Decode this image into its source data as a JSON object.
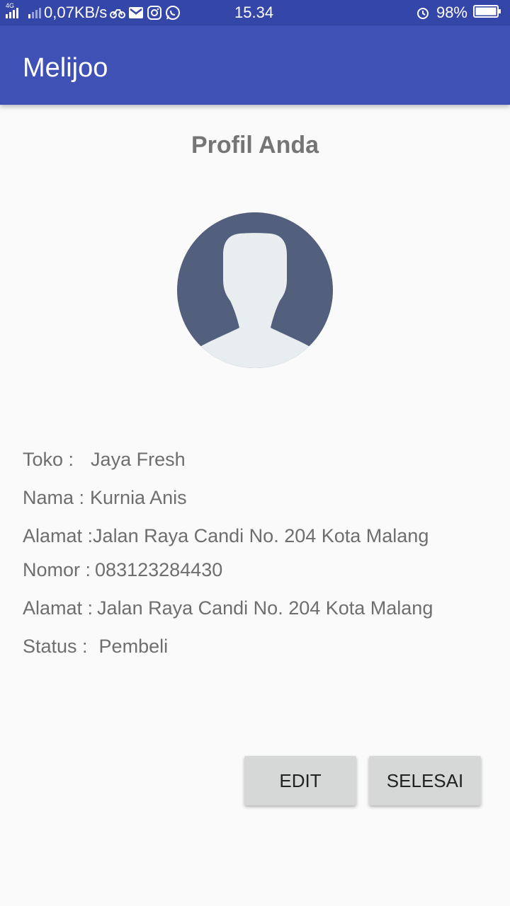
{
  "status_bar": {
    "network_label": "4G",
    "data_rate": "0,07KB/s",
    "time": "15.34",
    "battery": "98%",
    "notification_icons": [
      "bike-icon",
      "gmail-icon",
      "instagram-icon",
      "whatsapp-icon"
    ],
    "right_icons": [
      "alarm-icon",
      "battery-icon"
    ]
  },
  "app_bar": {
    "title": "Melijoo",
    "color": "#3f51b5"
  },
  "profile": {
    "heading": "Profil Anda",
    "avatar_icon": "user-avatar-icon",
    "rows": [
      {
        "label": "Toko :",
        "value": "Jaya Fresh"
      },
      {
        "label": "Nama :",
        "value": "Kurnia Anis"
      },
      {
        "label": "Alamat :",
        "value": "Jalan Raya Candi No. 204 Kota Malang"
      },
      {
        "label": "Nomor :",
        "value": "083123284430"
      },
      {
        "label": "Alamat :",
        "value": "Jalan Raya Candi No. 204 Kota Malang"
      },
      {
        "label": "Status :",
        "value": "Pembeli"
      }
    ]
  },
  "actions": {
    "edit_label": "EDIT",
    "done_label": "SELESAI"
  }
}
